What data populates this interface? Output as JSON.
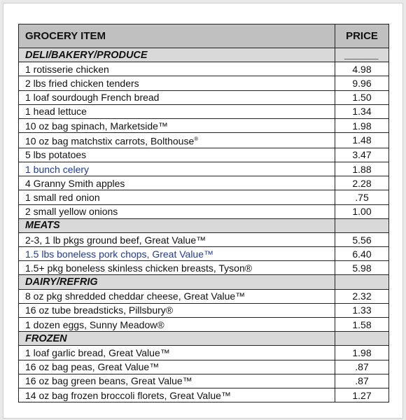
{
  "header": {
    "item": "GROCERY ITEM",
    "price": "PRICE"
  },
  "text_colors": {
    "default": "#111111",
    "highlight": "#1f3aa0"
  },
  "sections": [
    {
      "name": "DELI/BAKERY/PRODUCE",
      "price": "______",
      "items": [
        {
          "item": "1 rotisserie chicken",
          "price": "4.98"
        },
        {
          "item": "2 lbs fried chicken tenders",
          "price": "9.96"
        },
        {
          "item": "1 loaf sourdough French bread",
          "price": "1.50"
        },
        {
          "item": "1 head lettuce",
          "price": "1.34"
        },
        {
          "item": "10 oz bag spinach, Marketside™",
          "price": "1.98"
        },
        {
          "item": "10 oz bag matchstix carrots, Bolthouse",
          "sup": "®",
          "price": "1.48"
        },
        {
          "item": "5 lbs potatoes",
          "price": "3.47"
        },
        {
          "item": "1 bunch celery",
          "price": "1.88",
          "blue": true
        },
        {
          "item": "4 Granny Smith apples",
          "price": "2.28"
        },
        {
          "item": "1 small red onion",
          "price": ".75"
        },
        {
          "item": "2 small yellow onions",
          "price": "1.00"
        }
      ]
    },
    {
      "name": "MEATS",
      "price": "",
      "items": [
        {
          "item": "2-3, 1 lb pkgs ground beef, Great Value™",
          "price": "5.56"
        },
        {
          "item": "1.5 lbs boneless pork chops, Great Value™",
          "price": "6.40",
          "blue": true
        },
        {
          "item": "1.5+ pkg boneless skinless chicken breasts, Tyson®",
          "price": "5.98"
        }
      ]
    },
    {
      "name": "DAIRY/REFRIG",
      "price": "",
      "items": [
        {
          "item": "8 oz pkg shredded cheddar cheese, Great Value™",
          "price": "2.32"
        },
        {
          "item": "16 oz tube breadsticks, Pillsbury®",
          "price": "1.33"
        },
        {
          "item": "1 dozen eggs, Sunny Meadow®",
          "price": "1.58"
        }
      ]
    },
    {
      "name": "FROZEN",
      "price": "",
      "items": [
        {
          "item": "1 loaf garlic bread, Great Value™",
          "price": "1.98"
        },
        {
          "item": "16 oz bag peas, Great Value™",
          "price": ".87"
        },
        {
          "item": "16 oz bag green beans, Great Value™",
          "price": ".87"
        },
        {
          "item": "14 oz bag frozen broccoli florets, Great Value™",
          "price": "1.27"
        }
      ]
    }
  ]
}
